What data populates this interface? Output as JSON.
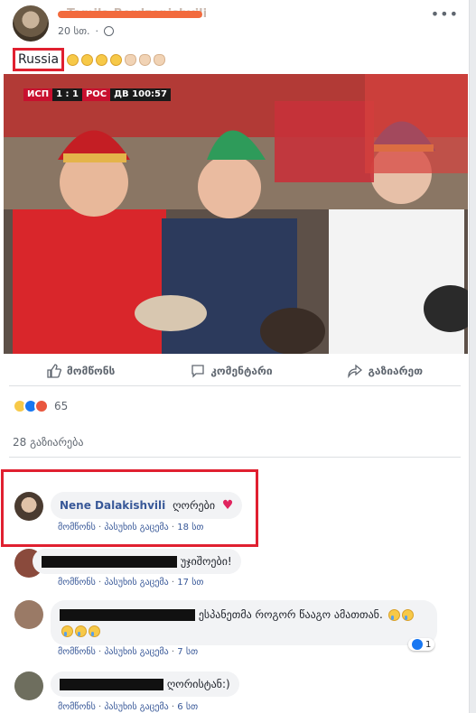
{
  "post": {
    "author_name": "Tamila Berdzenishvili",
    "timestamp": "20 სთ.",
    "privacy_icon": "globe-icon",
    "more_icon": "more-options-icon",
    "text": "Russia",
    "emoji": [
      "grinning-squint",
      "grinning-squint",
      "grinning-squint",
      "grinning-squint",
      "ok-hand",
      "ok-hand",
      "ok-hand"
    ]
  },
  "photo": {
    "scoreboard": {
      "team_a": "ИСП",
      "score": "1 : 1",
      "team_b": "РОС",
      "period": "ДВ 100:57"
    }
  },
  "actions": [
    {
      "label": "მომწონს",
      "icon": "like-icon"
    },
    {
      "label": "კომენტარი",
      "icon": "comment-icon"
    },
    {
      "label": "გაზიარეთ",
      "icon": "share-icon"
    }
  ],
  "reactions": {
    "types": [
      "haha",
      "like",
      "angry"
    ],
    "count": "65"
  },
  "shares": "28 გაზიარება",
  "comments": [
    {
      "name": "Nene Dalakishvili",
      "text": "ღორები",
      "reaction_emoji": "heart-icon",
      "actions": [
        "მომწონს",
        "პასუხის გაცემა"
      ],
      "time": "18 სთ",
      "highlighted": true
    },
    {
      "name": "",
      "text": "უჯიშოები!",
      "actions": [
        "მომწონს",
        "პასუხის გაცემა"
      ],
      "time": "17 სთ"
    },
    {
      "name": "",
      "text": "ესპანეთმა როგორ წააგო ამათთან.",
      "actions": [
        "მომწონს",
        "პასუხის გაცემა"
      ],
      "time": "7 სთ",
      "likes": "1"
    },
    {
      "name": "",
      "text": "ღორისტან:)",
      "actions": [
        "მომწონს",
        "პასუხის გაცემა"
      ],
      "time": "6 სთ"
    }
  ],
  "colors": {
    "highlight_red": "#e02030",
    "link_blue": "#385898",
    "redaction_orange": "#f26a3d"
  }
}
